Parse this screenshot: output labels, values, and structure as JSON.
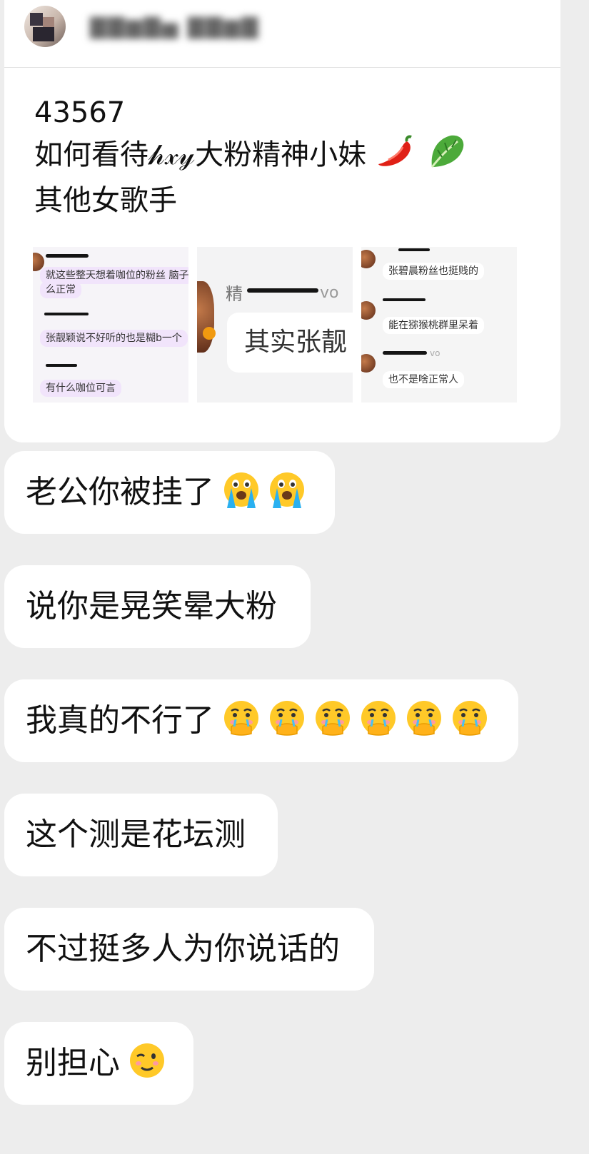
{
  "post": {
    "title_line1": "43567",
    "title_line2": "如何看待𝒽𝓍𝓎大粉精神小妹",
    "title_line3": "其他女歌手",
    "inline_emojis": [
      "chili-pepper",
      "leafy-green"
    ],
    "thumbnails": [
      {
        "lines": [
          "就这些整天想着咖位的粉丝 脑子",
          "么正常",
          "张靓颖说不好听的也是糊b一个",
          "有什么咖位可言"
        ]
      },
      {
        "header_fragment": "精",
        "header_suffix": "vo",
        "big_text": "其实张靓"
      },
      {
        "lines": [
          "张碧晨粉丝也挺贱的",
          "能在猕猴桃群里呆着",
          "也不是啥正常人"
        ],
        "suffix": "vo"
      }
    ]
  },
  "messages": [
    {
      "text": "老公你被挂了",
      "emoji": "loudly-crying",
      "emoji_count": 2
    },
    {
      "text": "说你是晃笑晕大粉",
      "emoji": "",
      "emoji_count": 0
    },
    {
      "text": "我真的不行了",
      "emoji": "holding-back-tears",
      "emoji_count": 6
    },
    {
      "text": "这个测是花坛测",
      "emoji": "",
      "emoji_count": 0
    },
    {
      "text": "不过挺多人为你说话的",
      "emoji": "",
      "emoji_count": 0
    },
    {
      "text": "别担心",
      "emoji": "winking-face",
      "emoji_count": 1
    }
  ]
}
